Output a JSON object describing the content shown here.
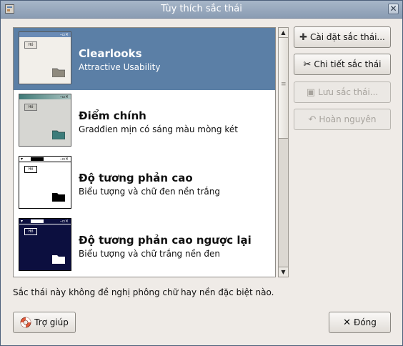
{
  "window": {
    "title": "Tùy thích sắc thái"
  },
  "themes": [
    {
      "name": "Clearlooks",
      "desc": "Attractive Usability",
      "selected": true
    },
    {
      "name": "Điểm chính",
      "desc": "Gradđien mịn có sáng màu mòng két",
      "selected": false
    },
    {
      "name": "Độ tương phản cao",
      "desc": "Biểu tượng và chữ đen nền trắng",
      "selected": false
    },
    {
      "name": "Độ tương phản cao ngược lại",
      "desc": "Biểu tượng và chữ trắng nền đen",
      "selected": false
    }
  ],
  "side_buttons": {
    "install": "Cài đặt sắc thái...",
    "details": "Chi tiết sắc thái",
    "save": "Lưu sắc thái...",
    "revert": "Hoàn nguyên"
  },
  "status_text": "Sắc thái này không đề nghị phông chữ hay nền đặc biệt nào.",
  "bottom_buttons": {
    "help": "Trợ giúp",
    "close": "Đóng"
  },
  "thumb_label": "Hồ"
}
